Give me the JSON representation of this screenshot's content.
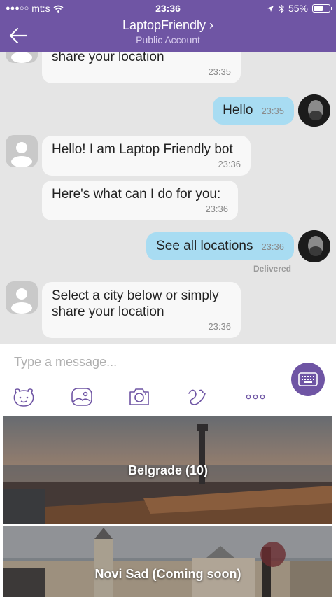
{
  "status_bar": {
    "carrier": "mt:s",
    "time": "23:36",
    "battery": "55%"
  },
  "header": {
    "title": "LaptopFriendly",
    "title_chevron": "›",
    "subtitle": "Public Account"
  },
  "messages": [
    {
      "direction": "in",
      "text": "share your location",
      "time": "23:35"
    },
    {
      "direction": "out",
      "text": "Hello",
      "time": "23:35"
    },
    {
      "direction": "in",
      "text": "Hello! I am Laptop Friendly bot",
      "time": "23:36"
    },
    {
      "direction": "in",
      "text": "Here's what can I do for you:",
      "time": "23:36"
    },
    {
      "direction": "out",
      "text": "See all locations",
      "time": "23:36"
    },
    {
      "direction": "in",
      "text": "Select a city below or simply share your location",
      "time": "23:36"
    }
  ],
  "delivered_label": "Delivered",
  "composer": {
    "placeholder": "Type a message...",
    "tools": [
      "sticker-icon",
      "gallery-icon",
      "camera-icon",
      "doodle-icon",
      "more-icon"
    ]
  },
  "keyboard": {
    "buttons": [
      {
        "label": "Belgrade (10)"
      },
      {
        "label": "Novi Sad (Coming soon)"
      }
    ]
  },
  "colors": {
    "header": "#6f55a4",
    "outgoing_bubble": "#a8dcf2",
    "incoming_bubble": "#f8f8f8",
    "chat_background": "#e5e5e5"
  }
}
